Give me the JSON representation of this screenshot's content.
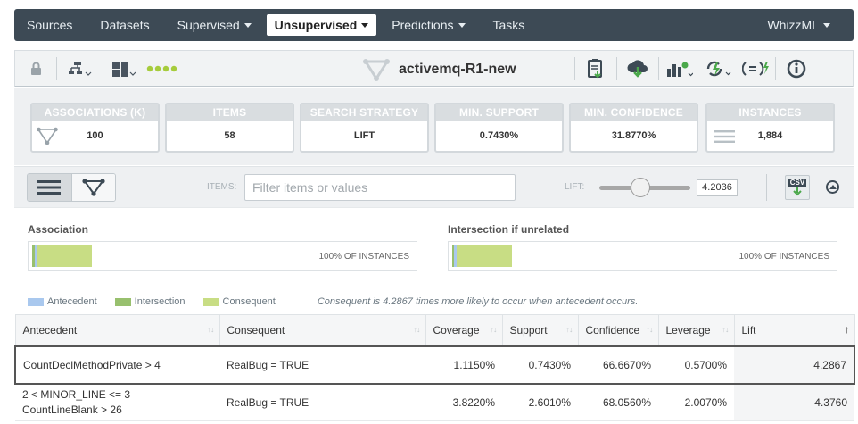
{
  "nav": {
    "items": [
      {
        "label": "Sources",
        "dropdown": false,
        "active": false
      },
      {
        "label": "Datasets",
        "dropdown": false,
        "active": false
      },
      {
        "label": "Supervised",
        "dropdown": true,
        "active": false
      },
      {
        "label": "Unsupervised",
        "dropdown": true,
        "active": true
      },
      {
        "label": "Predictions",
        "dropdown": true,
        "active": false
      },
      {
        "label": "Tasks",
        "dropdown": false,
        "active": false
      }
    ],
    "user_menu": "WhizzML"
  },
  "toolbar": {
    "title": "activemq-R1-new",
    "icons_left": [
      "lock-icon",
      "model-tree-icon",
      "numbers-icon",
      "progress-dots-icon"
    ],
    "icons_right": [
      "download-report-icon",
      "cloud-download-icon",
      "bar-chart-settings-icon",
      "lightning-icon",
      "formula-icon",
      "info-icon"
    ]
  },
  "stats": [
    {
      "label": "ASSOCIATIONS (K)",
      "value": "100",
      "icon": "association-icon"
    },
    {
      "label": "ITEMS",
      "value": "58"
    },
    {
      "label": "SEARCH STRATEGY",
      "value": "LIFT"
    },
    {
      "label": "MIN. SUPPORT",
      "value": "0.7430%"
    },
    {
      "label": "MIN. CONFIDENCE",
      "value": "31.8770%"
    },
    {
      "label": "INSTANCES",
      "value": "1,884",
      "icon": "list-icon"
    }
  ],
  "controls": {
    "items_label": "ITEMS:",
    "filter_placeholder": "Filter items or values",
    "lift_label": "LIFT:",
    "lift_value": "4.2036",
    "lift_slider_fraction": 0.45,
    "csv_label": "CSV"
  },
  "bars": {
    "association": {
      "title": "Association",
      "instances_label": "100% OF INSTANCES",
      "antecedent_fraction": 0.011,
      "intersection_fraction": 0.0074,
      "consequent_fraction": 0.156
    },
    "unrelated": {
      "title": "Intersection if unrelated",
      "instances_label": "100% OF INSTANCES",
      "antecedent_fraction": 0.011,
      "intersection_fraction": 0.0017,
      "consequent_fraction": 0.156
    }
  },
  "legend": {
    "antecedent": "Antecedent",
    "intersection": "Intersection",
    "consequent": "Consequent",
    "note": "Consequent is 4.2867 times more likely to occur when antecedent occurs.",
    "colors": {
      "antecedent": "#a9c8ee",
      "intersection": "#98c06e",
      "consequent": "#c8dd84"
    }
  },
  "table": {
    "columns": [
      "Antecedent",
      "Consequent",
      "Coverage",
      "Support",
      "Confidence",
      "Leverage",
      "Lift"
    ],
    "sorted_by": "Lift",
    "rows": [
      {
        "antecedent": [
          "CountDeclMethodPrivate > 4"
        ],
        "consequent": "RealBug = TRUE",
        "coverage": "1.1150%",
        "support": "0.7430%",
        "confidence": "66.6670%",
        "leverage": "0.5700%",
        "lift": "4.2867",
        "selected": true
      },
      {
        "antecedent": [
          "2 < MINOR_LINE <= 3",
          "CountLineBlank > 26"
        ],
        "consequent": "RealBug = TRUE",
        "coverage": "3.8220%",
        "support": "2.6010%",
        "confidence": "68.0560%",
        "leverage": "2.0070%",
        "lift": "4.3760",
        "selected": false
      }
    ]
  }
}
